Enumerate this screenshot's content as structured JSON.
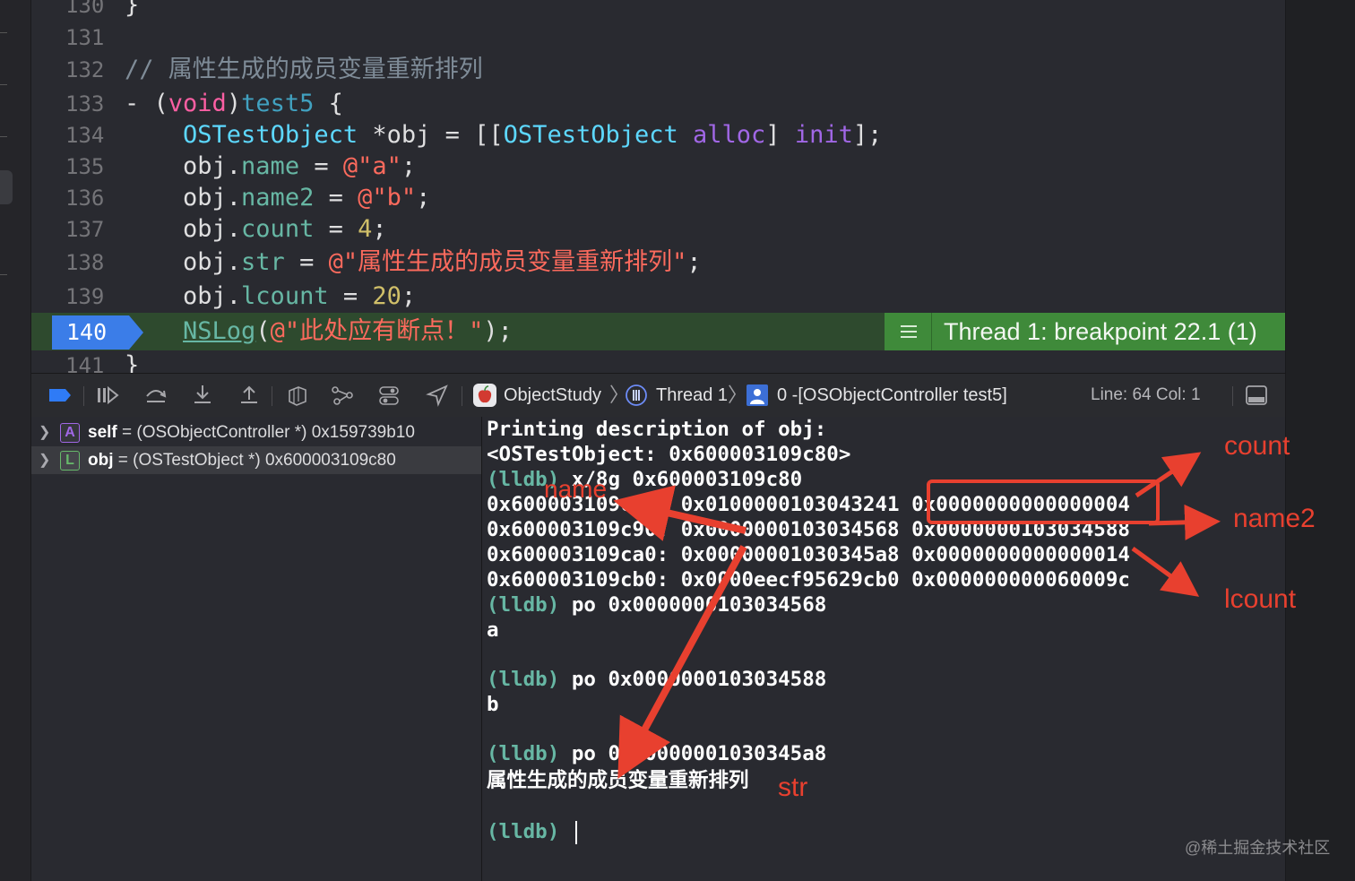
{
  "editor": {
    "lines": [
      {
        "num": "130",
        "tokens": [
          {
            "t": "}",
            "c": ""
          }
        ]
      },
      {
        "num": "131",
        "tokens": []
      },
      {
        "num": "132",
        "tokens": [
          {
            "t": "// 属性生成的成员变量重新排列",
            "c": "c-comment"
          }
        ]
      },
      {
        "num": "133",
        "tokens": [
          {
            "t": "- (",
            "c": ""
          },
          {
            "t": "void",
            "c": "c-kw"
          },
          {
            "t": ")",
            "c": ""
          },
          {
            "t": "test5",
            "c": "c-decl"
          },
          {
            "t": " {",
            "c": ""
          }
        ]
      },
      {
        "num": "134",
        "tokens": [
          {
            "t": "    ",
            "c": ""
          },
          {
            "t": "OSTestObject",
            "c": "c-type"
          },
          {
            "t": " *obj = [[",
            "c": ""
          },
          {
            "t": "OSTestObject",
            "c": "c-type"
          },
          {
            "t": " ",
            "c": ""
          },
          {
            "t": "alloc",
            "c": "c-method"
          },
          {
            "t": "] ",
            "c": ""
          },
          {
            "t": "init",
            "c": "c-method"
          },
          {
            "t": "];",
            "c": ""
          }
        ]
      },
      {
        "num": "135",
        "tokens": [
          {
            "t": "    obj.",
            "c": ""
          },
          {
            "t": "name",
            "c": "c-prop"
          },
          {
            "t": " = ",
            "c": ""
          },
          {
            "t": "@\"a\"",
            "c": "c-str"
          },
          {
            "t": ";",
            "c": ""
          }
        ]
      },
      {
        "num": "136",
        "tokens": [
          {
            "t": "    obj.",
            "c": ""
          },
          {
            "t": "name2",
            "c": "c-prop"
          },
          {
            "t": " = ",
            "c": ""
          },
          {
            "t": "@\"b\"",
            "c": "c-str"
          },
          {
            "t": ";",
            "c": ""
          }
        ]
      },
      {
        "num": "137",
        "tokens": [
          {
            "t": "    obj.",
            "c": ""
          },
          {
            "t": "count",
            "c": "c-prop"
          },
          {
            "t": " = ",
            "c": ""
          },
          {
            "t": "4",
            "c": "c-num"
          },
          {
            "t": ";",
            "c": ""
          }
        ]
      },
      {
        "num": "138",
        "tokens": [
          {
            "t": "    obj.",
            "c": ""
          },
          {
            "t": "str",
            "c": "c-prop"
          },
          {
            "t": " = ",
            "c": ""
          },
          {
            "t": "@\"属性生成的成员变量重新排列\"",
            "c": "c-str"
          },
          {
            "t": ";",
            "c": ""
          }
        ]
      },
      {
        "num": "139",
        "tokens": [
          {
            "t": "    obj.",
            "c": ""
          },
          {
            "t": "lcount",
            "c": "c-prop"
          },
          {
            "t": " = ",
            "c": ""
          },
          {
            "t": "20",
            "c": "c-num"
          },
          {
            "t": ";",
            "c": ""
          }
        ]
      },
      {
        "num": "140",
        "tokens": [
          {
            "t": "    ",
            "c": ""
          },
          {
            "t": "NSLog",
            "c": "c-fn"
          },
          {
            "t": "(",
            "c": ""
          },
          {
            "t": "@\"此处应有断点！\"",
            "c": "c-str"
          },
          {
            "t": ");",
            "c": ""
          }
        ]
      },
      {
        "num": "141",
        "tokens": [
          {
            "t": "}",
            "c": ""
          }
        ]
      }
    ],
    "breakpoint_line": "140",
    "thread_banner": "Thread 1: breakpoint 22.1 (1)"
  },
  "debug_bar": {
    "crumbs": [
      "ObjectStudy",
      "Thread 1",
      "0 -[OSObjectController test5]"
    ],
    "line_col": "Line: 64  Col: 1"
  },
  "variables": [
    {
      "badge": "A",
      "name": "self",
      "value": "= (OSObjectController *) 0x159739b10",
      "badge_color": "#a167e6"
    },
    {
      "badge": "L",
      "name": "obj",
      "value": "= (OSTestObject *) 0x600003109c80",
      "badge_color": "#67b96b"
    }
  ],
  "console": {
    "lines": [
      {
        "prompt": "",
        "text": "Printing description of obj:"
      },
      {
        "prompt": "",
        "text": "<OSTestObject: 0x600003109c80>"
      },
      {
        "prompt": "(lldb)",
        "text": " x/8g 0x600003109c80"
      },
      {
        "prompt": "",
        "text": "0x600003109c80: 0x0100000103043241 0x0000000000000004"
      },
      {
        "prompt": "",
        "text": "0x600003109c90: 0x0000000103034568 0x0000000103034588"
      },
      {
        "prompt": "",
        "text": "0x600003109ca0: 0x00000001030345a8 0x0000000000000014"
      },
      {
        "prompt": "",
        "text": "0x600003109cb0: 0x0000eecf95629cb0 0x000000000060009c"
      },
      {
        "prompt": "(lldb)",
        "text": " po 0x0000000103034568"
      },
      {
        "prompt": "",
        "text": "a"
      },
      {
        "prompt": "",
        "text": ""
      },
      {
        "prompt": "(lldb)",
        "text": " po 0x0000000103034588"
      },
      {
        "prompt": "",
        "text": "b"
      },
      {
        "prompt": "",
        "text": ""
      },
      {
        "prompt": "(lldb)",
        "text": " po 0x00000001030345a8"
      },
      {
        "prompt": "",
        "text": "属性生成的成员变量重新排列"
      },
      {
        "prompt": "",
        "text": ""
      },
      {
        "prompt": "(lldb)",
        "text": " "
      }
    ]
  },
  "annotations": {
    "count": "count",
    "name2": "name2",
    "lcount": "lcount",
    "name": "name",
    "str": "str",
    "color": "#e8402f"
  },
  "watermark": "@稀土掘金技术社区"
}
